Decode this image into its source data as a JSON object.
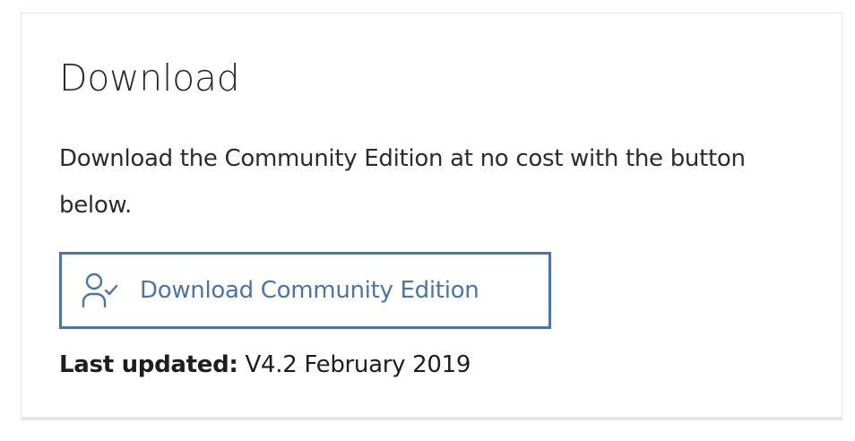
{
  "card": {
    "title": "Download",
    "description": "Download the Community Edition at no cost with the button below.",
    "button": {
      "label": "Download Community Edition",
      "icon": "user-check-icon",
      "color": "#4d74a4"
    },
    "last_updated": {
      "key": "Last updated:",
      "value": "V4.2 February 2019"
    }
  }
}
